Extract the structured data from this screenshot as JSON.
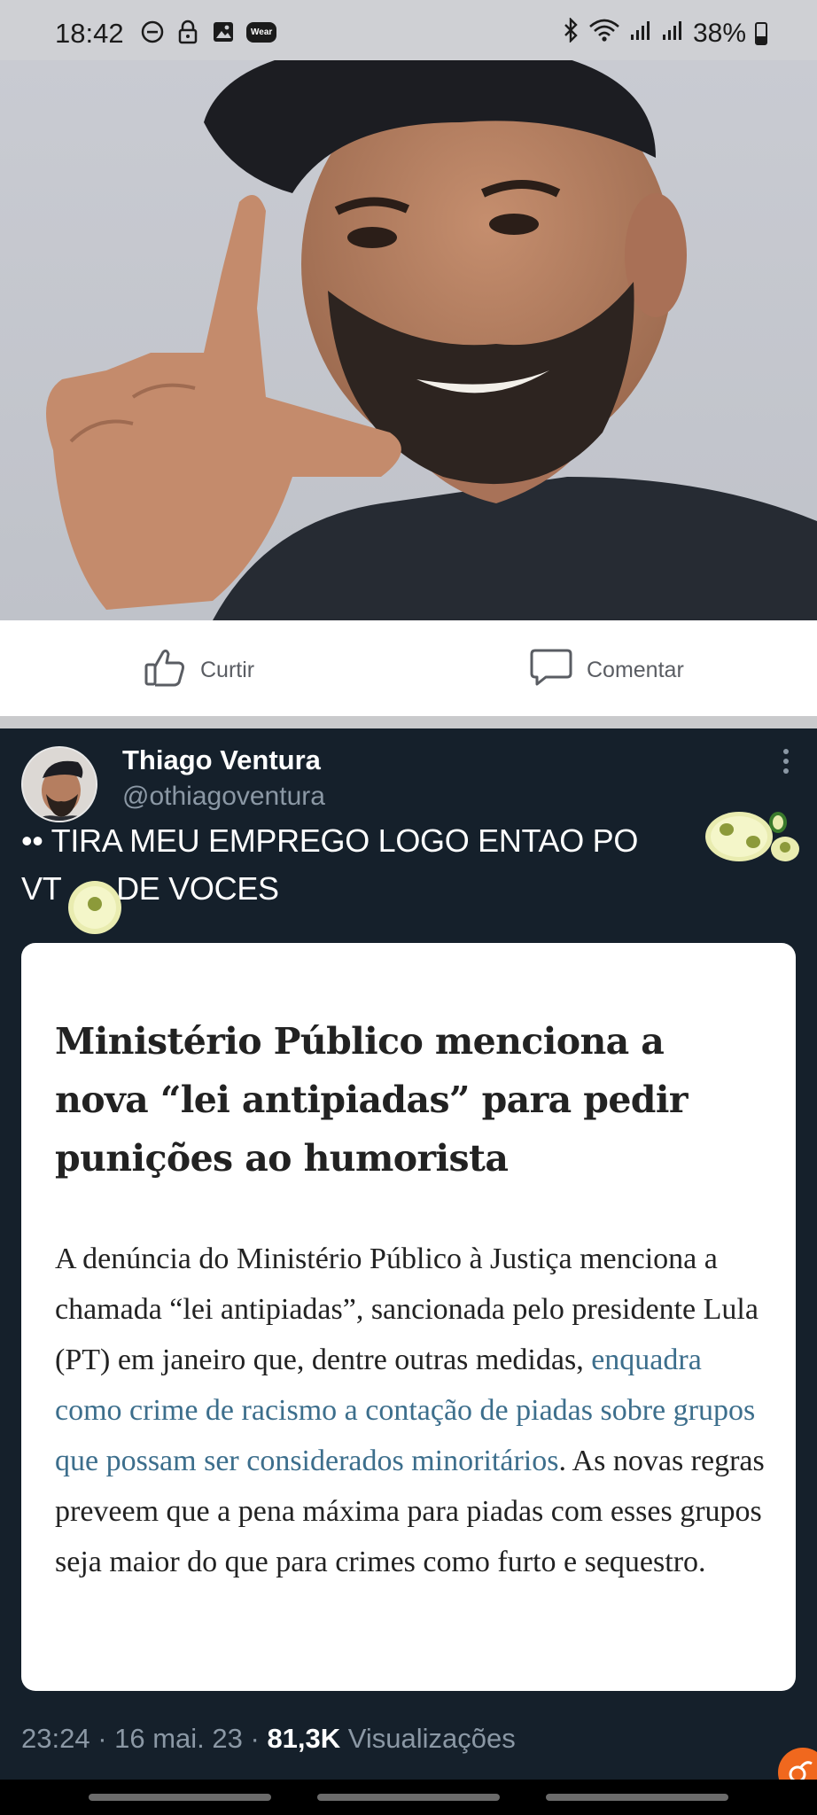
{
  "status_bar": {
    "time": "18:42",
    "battery": "38%",
    "wear_label": "Wear",
    "icons": [
      "do-not-disturb-icon",
      "lock-icon",
      "gallery-icon",
      "wear-icon",
      "bluetooth-icon",
      "wifi-icon",
      "signal-icon",
      "signal-icon",
      "battery-icon"
    ]
  },
  "facebook_actions": {
    "like_label": "Curtir",
    "comment_label": "Comentar"
  },
  "tweet": {
    "author_name": "Thiago Ventura",
    "author_handle": "@othiagoventura",
    "text_line1": "•• TIRA MEU EMPREGO LOGO ENTAO PO",
    "text_line2_a": "VT",
    "text_line2_b": " DE VOCES",
    "card": {
      "title": "Ministério Público menciona a nova “lei antipiadas” para pedir punições ao humorista",
      "body_before": "A denúncia do Ministério Público à Justiça menciona a chamada “lei antipiadas”, sancionada pelo presidente Lula (PT) em janeiro que, dentre outras medidas, ",
      "body_link": "enquadra como crime de racismo a contação de piadas sobre grupos que possam ser considerados minoritários",
      "body_after": ". As novas regras preveem que a pena máxima para piadas com esses grupos seja maior do que para crimes como furto e sequestro."
    },
    "time": "23:24 · 16 mai. 23 · ",
    "views_count": "81,3K",
    "views_label": " Visualizações"
  },
  "colors": {
    "tweet_bg": "#15202b",
    "secondary_text": "#8b98a5",
    "link_text": "#3c6e8c",
    "accent_orange": "#f0681e"
  }
}
